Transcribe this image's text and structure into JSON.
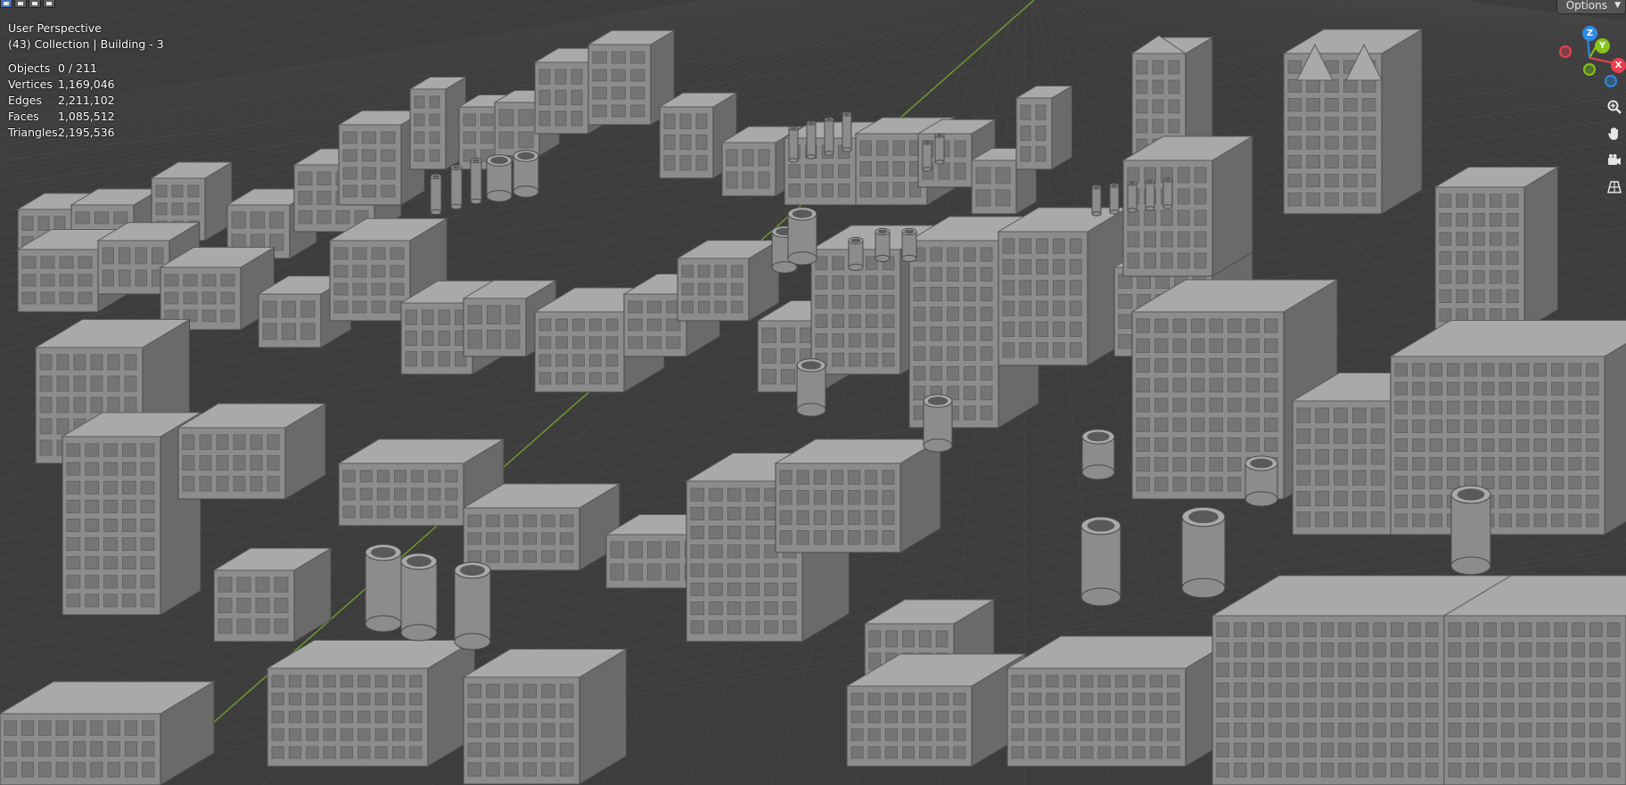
{
  "viewport": {
    "view_name": "User Perspective",
    "collection_line": "(43) Collection | Building - 3"
  },
  "stats": [
    {
      "label": "Objects",
      "value": "0 / 211"
    },
    {
      "label": "Vertices",
      "value": "1,169,046"
    },
    {
      "label": "Edges",
      "value": "2,211,102"
    },
    {
      "label": "Faces",
      "value": "1,085,512"
    },
    {
      "label": "Triangles",
      "value": "2,195,536"
    }
  ],
  "header": {
    "options_label": "Options",
    "options_icon": "chevron-down-icon",
    "mode_buttons": [
      "select-box-icon",
      "select-extend-icon",
      "select-subtract-icon",
      "select-invert-icon"
    ]
  },
  "gizmo": {
    "x_label": "X",
    "y_label": "Y",
    "z_label": "Z",
    "colors": {
      "x": "#e8404e",
      "y": "#87c41f",
      "z": "#2e8ae4"
    }
  },
  "tools": [
    "zoom-icon",
    "hand-pan-icon",
    "camera-icon",
    "perspective-grid-icon"
  ],
  "colors": {
    "background": "#3d3d3d",
    "grid": "#454545",
    "grid_major": "#4c4c4c",
    "y_axis_line": "#6d9a2c",
    "building_light": "#a9a9a9",
    "building_mid": "#8c8c8c",
    "building_dark": "#6a6a6a"
  }
}
